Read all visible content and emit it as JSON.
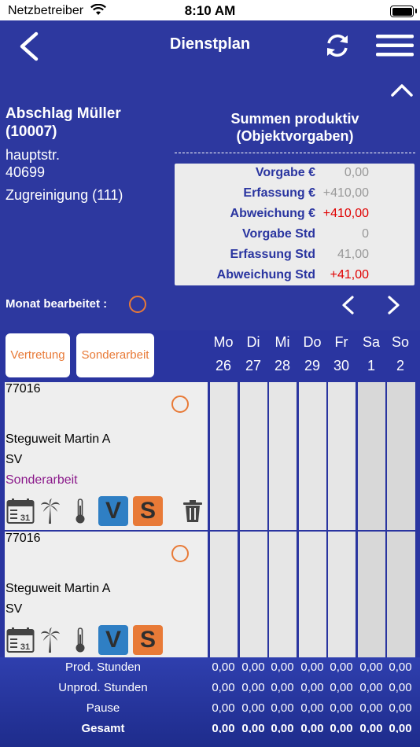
{
  "status": {
    "carrier": "Netzbetreiber",
    "time": "8:10 AM"
  },
  "nav": {
    "title": "Dienstplan"
  },
  "object": {
    "name": "Abschlag Müller",
    "id": "(10007)",
    "street": "hauptstr.",
    "zip": "40699",
    "type": "Zugreinigung (111)"
  },
  "summary": {
    "title_line1": "Summen produktiv",
    "title_line2": "(Objektvorgaben)",
    "rows": [
      {
        "label": "Vorgabe €",
        "value": "0,00"
      },
      {
        "label": "Erfassung €",
        "value": "+410,00"
      },
      {
        "label": "Abweichung €",
        "value": "+410,00"
      },
      {
        "label": "Vorgabe Std",
        "value": "0"
      },
      {
        "label": "Erfassung Std",
        "value": "41,00"
      },
      {
        "label": "Abweichung Std",
        "value": "+41,00"
      }
    ]
  },
  "monat_label": "Monat bearbeitet :",
  "buttons": {
    "vertretung": "Vertretung",
    "sonderarbeit": "Sonderarbeit"
  },
  "days": [
    {
      "name": "Mo",
      "num": "26"
    },
    {
      "name": "Di",
      "num": "27"
    },
    {
      "name": "Mi",
      "num": "28"
    },
    {
      "name": "Do",
      "num": "29"
    },
    {
      "name": "Fr",
      "num": "30"
    },
    {
      "name": "Sa",
      "num": "1"
    },
    {
      "name": "So",
      "num": "2"
    }
  ],
  "employees": [
    {
      "code": "77016",
      "name": "Steguweit Martin A",
      "role": "SV",
      "note": "Sonderarbeit",
      "v": "V",
      "s": "S",
      "calendar_day": "31"
    },
    {
      "code": "77016",
      "name": "Steguweit Martin A",
      "role": "SV",
      "note": "",
      "v": "V",
      "s": "S",
      "calendar_day": "31"
    }
  ],
  "footer": {
    "rows": [
      {
        "label": "Prod. Stunden",
        "values": [
          "0,00",
          "0,00",
          "0,00",
          "0,00",
          "0,00",
          "0,00",
          "0,00"
        ]
      },
      {
        "label": "Unprod. Stunden",
        "values": [
          "0,00",
          "0,00",
          "0,00",
          "0,00",
          "0,00",
          "0,00",
          "0,00"
        ]
      },
      {
        "label": "Pause",
        "values": [
          "0,00",
          "0,00",
          "0,00",
          "0,00",
          "0,00",
          "0,00",
          "0,00"
        ]
      },
      {
        "label": "Gesamt",
        "values": [
          "0,00",
          "0,00",
          "0,00",
          "0,00",
          "0,00",
          "0,00",
          "0,00"
        ]
      }
    ]
  },
  "colors": {
    "primary": "#2d389f",
    "accent": "#e87a37",
    "danger": "#e00000",
    "purple": "#8b1a8b",
    "v_button": "#2f7fc4"
  }
}
